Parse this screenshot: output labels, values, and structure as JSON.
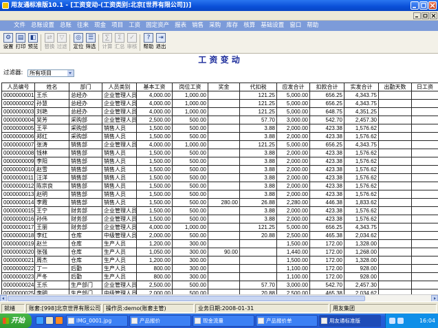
{
  "window": {
    "title": "用友通标准版10.1 - [工资变动-(工资类别:北京[世界有限公司])]",
    "app_icon": "app-icon"
  },
  "menu": [
    "文件",
    "总账设置",
    "总账",
    "往来",
    "现金",
    "项目",
    "工资",
    "固定资产",
    "报表",
    "销售",
    "采购",
    "库存",
    "核算",
    "基础设置",
    "窗口",
    "帮助"
  ],
  "toolbar": [
    {
      "label": "设置",
      "icon": "settings-icon",
      "enabled": true
    },
    {
      "label": "打印",
      "icon": "print-icon",
      "enabled": true
    },
    {
      "label": "预览",
      "icon": "preview-icon",
      "enabled": true
    },
    {
      "label": "替换",
      "icon": "replace-icon",
      "enabled": false
    },
    {
      "label": "过滤",
      "icon": "filter-icon",
      "enabled": false
    },
    {
      "label": "定位",
      "icon": "locate-icon",
      "enabled": true
    },
    {
      "label": "筛选",
      "icon": "screen-icon",
      "enabled": true
    },
    {
      "label": "计算",
      "icon": "calculate-icon",
      "enabled": false
    },
    {
      "label": "汇总",
      "icon": "summary-icon",
      "enabled": false
    },
    {
      "label": "审核",
      "icon": "audit-icon",
      "enabled": false
    },
    {
      "label": "帮助",
      "icon": "help-icon",
      "enabled": true
    },
    {
      "label": "退出",
      "icon": "exit-icon",
      "enabled": true
    }
  ],
  "page": {
    "heading": "工 资 变 动",
    "filter_label": "过滤器:",
    "filter_value": "所有项目"
  },
  "table": {
    "columns": [
      "人员编号",
      "姓名",
      "部门",
      "人员类别",
      "基本工资",
      "岗位工资",
      "奖金",
      "代扣税",
      "应发合计",
      "扣款合计",
      "实发合计",
      "出勤天数",
      "日工资"
    ],
    "rows": [
      [
        "0000000001",
        "王乐",
        "总经办",
        "企业管理人员",
        "4,000.00",
        "1,000.00",
        "",
        "121.25",
        "5,000.00",
        "656.25",
        "4,343.75",
        "",
        ""
      ],
      [
        "0000000002",
        "孙慧",
        "总经办",
        "企业管理人员",
        "4,000.00",
        "1,000.00",
        "",
        "121.25",
        "5,000.00",
        "656.25",
        "4,343.75",
        "",
        ""
      ],
      [
        "0000000003",
        "刘艳",
        "总经办",
        "企业管理人员",
        "4,000.00",
        "1,000.00",
        "",
        "121.25",
        "5,000.00",
        "648.75",
        "4,351.25",
        "",
        ""
      ],
      [
        "0000000004",
        "吴芳",
        "采购部",
        "企业管理人员",
        "2,500.00",
        "500.00",
        "",
        "57.70",
        "3,000.00",
        "542.70",
        "2,457.30",
        "",
        ""
      ],
      [
        "0000000005",
        "王平",
        "采购部",
        "销售人员",
        "1,500.00",
        "500.00",
        "",
        "3.88",
        "2,000.00",
        "423.38",
        "1,576.62",
        "",
        ""
      ],
      [
        "0000000006",
        "郑红",
        "采购部",
        "销售人员",
        "1,500.00",
        "500.00",
        "",
        "3.88",
        "2,000.00",
        "423.38",
        "1,576.62",
        "",
        ""
      ],
      [
        "0000000007",
        "张涛",
        "销售部",
        "企业管理人员",
        "4,000.00",
        "1,000.00",
        "",
        "121.25",
        "5,000.00",
        "656.25",
        "4,343.75",
        "",
        ""
      ],
      [
        "0000000008",
        "钱林",
        "销售部",
        "销售人员",
        "1,500.00",
        "500.00",
        "",
        "3.88",
        "2,000.00",
        "423.38",
        "1,576.62",
        "",
        ""
      ],
      [
        "0000000009",
        "李阳",
        "销售部",
        "销售人员",
        "1,500.00",
        "500.00",
        "",
        "3.88",
        "2,000.00",
        "423.38",
        "1,576.62",
        "",
        ""
      ],
      [
        "0000000010",
        "赵雪",
        "销售部",
        "销售人员",
        "1,500.00",
        "500.00",
        "",
        "3.88",
        "2,000.00",
        "423.38",
        "1,576.62",
        "",
        ""
      ],
      [
        "0000000011",
        "汪洋",
        "销售部",
        "销售人员",
        "1,500.00",
        "500.00",
        "",
        "3.88",
        "2,000.00",
        "423.38",
        "1,576.62",
        "",
        ""
      ],
      [
        "0000000012",
        "陈宗良",
        "销售部",
        "销售人员",
        "1,500.00",
        "500.00",
        "",
        "3.88",
        "2,000.00",
        "423.38",
        "1,576.62",
        "",
        ""
      ],
      [
        "0000000013",
        "赵明",
        "销售部",
        "销售人员",
        "1,500.00",
        "500.00",
        "",
        "3.88",
        "2,000.00",
        "423.38",
        "1,576.62",
        "",
        ""
      ],
      [
        "0000000014",
        "李霞",
        "销售部",
        "销售人员",
        "1,500.00",
        "500.00",
        "280.00",
        "26.88",
        "2,280.00",
        "446.38",
        "1,833.62",
        "",
        ""
      ],
      [
        "0000000015",
        "王宁",
        "财务部",
        "企业管理人员",
        "1,500.00",
        "500.00",
        "",
        "3.88",
        "2,000.00",
        "423.38",
        "1,576.62",
        "",
        ""
      ],
      [
        "0000000016",
        "孙伟",
        "财务部",
        "企业管理人员",
        "1,500.00",
        "500.00",
        "",
        "3.88",
        "2,000.00",
        "423.38",
        "1,576.62",
        "",
        ""
      ],
      [
        "0000000017",
        "王丽",
        "财务部",
        "企业管理人员",
        "4,000.00",
        "1,000.00",
        "",
        "121.25",
        "5,000.00",
        "656.25",
        "4,343.75",
        "",
        ""
      ],
      [
        "0000000018",
        "李红",
        "仓库",
        "中级管理人员",
        "2,000.00",
        "500.00",
        "",
        "20.88",
        "2,500.00",
        "465.38",
        "2,034.62",
        "",
        ""
      ],
      [
        "0000000019",
        "赵兰",
        "仓库",
        "生产人员",
        "1,200.00",
        "300.00",
        "",
        "",
        "1,500.00",
        "172.00",
        "1,328.00",
        "",
        ""
      ],
      [
        "0000000020",
        "张强",
        "仓库",
        "生产人员",
        "1,050.00",
        "300.00",
        "90.00",
        "",
        "1,440.00",
        "172.00",
        "1,268.00",
        "",
        ""
      ],
      [
        "0000000021",
        "周杰",
        "仓库",
        "生产人员",
        "1,200.00",
        "300.00",
        "",
        "",
        "1,500.00",
        "172.00",
        "1,328.00",
        "",
        ""
      ],
      [
        "0000000022",
        "丁一",
        "后勤",
        "生产人员",
        "800.00",
        "300.00",
        "",
        "",
        "1,100.00",
        "172.00",
        "928.00",
        "",
        ""
      ],
      [
        "0000000023",
        "严冬",
        "后勤",
        "生产人员",
        "800.00",
        "300.00",
        "",
        "",
        "1,100.00",
        "172.00",
        "928.00",
        "",
        ""
      ],
      [
        "0000000024",
        "王乐",
        "生产部门",
        "企业管理人员",
        "2,500.00",
        "500.00",
        "",
        "57.70",
        "3,000.00",
        "542.70",
        "2,457.30",
        "",
        ""
      ],
      [
        "0000000025",
        "李明",
        "生产部门",
        "中级管理人员",
        "2,000.00",
        "500.00",
        "",
        "20.88",
        "2,500.00",
        "465.38",
        "2,034.62",
        "",
        ""
      ]
    ]
  },
  "status": [
    "就绪",
    "账套:[998]北京世界有限公司",
    "操作员:demo(账套主管)",
    "业务日期:2008-01-31",
    "用友集团"
  ],
  "taskbar": {
    "start_label": "开始",
    "quick_launch": [
      "ie-icon",
      "desktop-icon",
      "media-player-icon"
    ],
    "tasks": [
      {
        "label": "IMG_0001.jpg",
        "icon": "image-icon",
        "active": false
      },
      {
        "label": "产品报价",
        "icon": "document-icon",
        "active": false
      },
      {
        "label": "现金流量",
        "icon": "document-icon",
        "active": false
      },
      {
        "label": "产品报价单",
        "icon": "spreadsheet-icon",
        "active": false
      },
      {
        "label": "用友通标准版",
        "icon": "yonyou-icon",
        "active": true
      }
    ],
    "tray_icons": [
      "network-icon",
      "volume-icon"
    ],
    "clock": "16:04"
  }
}
